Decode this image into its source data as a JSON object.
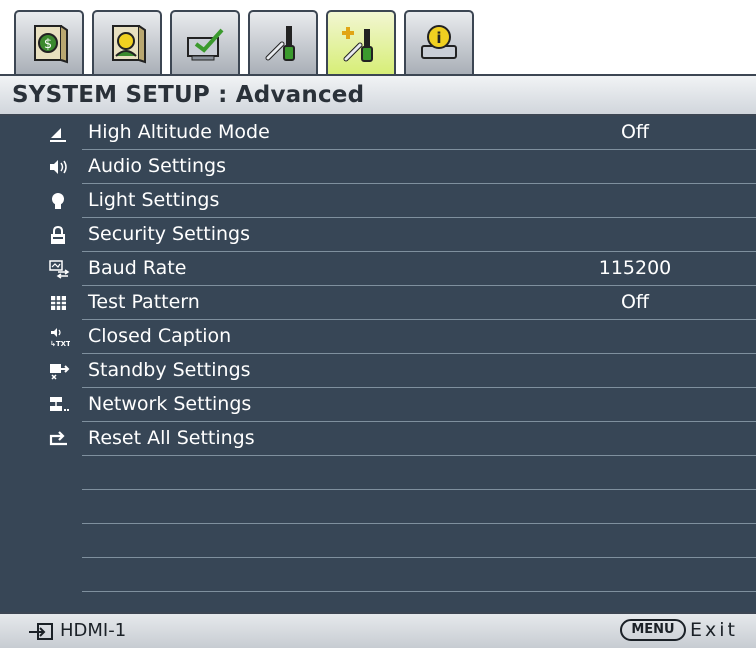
{
  "tabs": [
    {
      "icon": "picture-icon",
      "active": false
    },
    {
      "icon": "advanced-picture-icon",
      "active": false
    },
    {
      "icon": "display-icon",
      "active": false
    },
    {
      "icon": "system-setup-basic-icon",
      "active": false
    },
    {
      "icon": "system-setup-advanced-icon",
      "active": true
    },
    {
      "icon": "information-icon",
      "active": false
    }
  ],
  "header": {
    "title": "SYSTEM SETUP : Advanced"
  },
  "menu": {
    "items": [
      {
        "label": "High Altitude Mode",
        "value": "Off",
        "icon": "mountain-icon"
      },
      {
        "label": "Audio Settings",
        "value": "",
        "icon": "speaker-icon"
      },
      {
        "label": "Light Settings",
        "value": "",
        "icon": "lamp-icon"
      },
      {
        "label": "Security Settings",
        "value": "",
        "icon": "lock-icon"
      },
      {
        "label": "Baud Rate",
        "value": "115200",
        "icon": "baud-rate-icon"
      },
      {
        "label": "Test Pattern",
        "value": "Off",
        "icon": "grid-icon"
      },
      {
        "label": "Closed Caption",
        "value": "",
        "icon": "caption-icon"
      },
      {
        "label": "Standby Settings",
        "value": "",
        "icon": "standby-icon"
      },
      {
        "label": "Network Settings",
        "value": "",
        "icon": "network-icon"
      },
      {
        "label": "Reset All Settings",
        "value": "",
        "icon": "reset-icon"
      }
    ],
    "empty_rows": 4
  },
  "footer": {
    "source_label": "HDMI-1",
    "menu_key": "MENU",
    "exit_label": "Exit"
  },
  "colors": {
    "panel_bg": "#374656",
    "active_tab": "#d6ee74",
    "text": "#ffffff"
  }
}
